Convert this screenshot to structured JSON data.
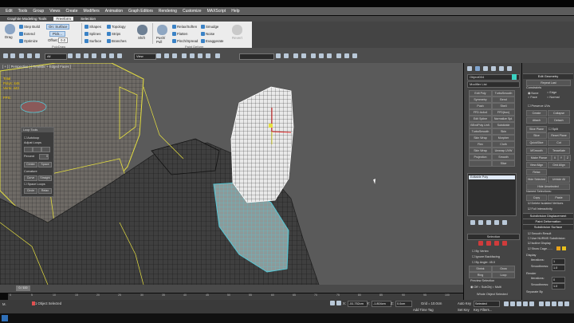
{
  "menu": [
    "Edit",
    "Tools",
    "Group",
    "Views",
    "Create",
    "Modifiers",
    "Animation",
    "Graph Editors",
    "Rendering",
    "Customize",
    "MAXScript",
    "Help"
  ],
  "ribbon_tabs": [
    "Graphite Modeling Tools",
    "Freeform",
    "Selection"
  ],
  "ribbon": {
    "step_build": "Step Build",
    "extend": "Extend",
    "optimize": "Optimize",
    "drag": "Drag",
    "on_surface": "On: Surface",
    "pick": "Pick...",
    "offset_label": "Offset:",
    "offset_value": "0.0",
    "shapes": "Shapes",
    "splines": "Splines",
    "surface": "Surface",
    "topology": "Topology",
    "strips": "Strips",
    "branches": "Branches",
    "shift": "Shift",
    "push_pull": "Push/ Pull",
    "relax_soften": "Relax/Soften",
    "flatten": "Flatten",
    "pinch_spread": "Pinch/Spread",
    "smudge": "Smudge",
    "noise": "Noise",
    "exaggerate": "Exaggerate",
    "revert": "Revert",
    "group_polydraw": "PolyDraw",
    "group_paint": "Paint Deform"
  },
  "toolbar": {
    "filter": "All",
    "view": "View",
    "selection_set": ""
  },
  "viewport": {
    "label": "[ + ] [ Perspective ] [ Realistic + Edged Faces ]",
    "stats_labels": [
      "Total",
      "Polys:",
      "Verts:",
      "FPS:"
    ],
    "stats_values": [
      "",
      "445",
      "443",
      ""
    ]
  },
  "loop_tools": {
    "title": "Loop Tools",
    "autoloop": "Autoloop",
    "adjust_loops": "Adjust Loops",
    "percent_label": "Percent",
    "percent_value": "0",
    "center": "Center",
    "space": "Space",
    "curvature": "Curvature",
    "curve": "Curve",
    "straight": "Straight",
    "space_loops": "Space Loops",
    "circle": "Circle",
    "relax": "Relax"
  },
  "modify_panel": {
    "object_name": "Object004",
    "modifier_list": "Modifier List",
    "buttons": [
      [
        "Edit Poly",
        "TurboSmooth"
      ],
      [
        "Symmetry",
        "Bend"
      ],
      [
        "Push",
        "Shell"
      ],
      [
        "FFD 4x4x4",
        "FFD(box)"
      ],
      [
        "Edit Spline",
        "Normalize Spl."
      ],
      [
        "BEndPoly Unfl.",
        "Subdivide"
      ],
      [
        "TurboSmooth",
        "Skin"
      ],
      [
        "Skin Wrap",
        "Morpher"
      ],
      [
        "Flex",
        "Cloth"
      ],
      [
        "Skin Wrap",
        "Unwrap UVW"
      ],
      [
        "Projection",
        "Smooth"
      ],
      [
        "",
        "Slice"
      ]
    ],
    "stack_item": "Editable Poly",
    "selection_header": "Selection",
    "by_vertex": "By Vertex",
    "ignore_backfacing": "Ignore Backfacing",
    "by_angle": "By Angle:",
    "by_angle_value": "45.0",
    "shrink": "Shrink",
    "grow": "Grow",
    "ring": "Ring",
    "loop": "Loop",
    "preview_selection": "Preview Selection",
    "off": "Off",
    "subobj": "SubObj",
    "multi": "Multi",
    "whole_selected": "Whole Object Selected"
  },
  "right_panel": {
    "edit_geometry": "Edit Geometry",
    "repeat_last": "Repeat Last",
    "constraints": "Constraints",
    "none": "None",
    "edge": "Edge",
    "face": "Face",
    "normal": "Normal",
    "preserve_uvs": "Preserve UVs",
    "create": "Create",
    "collapse": "Collapse",
    "attach": "Attach",
    "detach": "Detach",
    "slice_plane": "Slice Plane",
    "split": "Split",
    "slice": "Slice",
    "reset_plane": "Reset Plane",
    "quickslice": "QuickSlice",
    "cut": "Cut",
    "msmooth": "MSmooth",
    "tessellate": "Tessellate",
    "make_planar": "Make Planar",
    "x": "X",
    "y": "Y",
    "z": "Z",
    "view_align": "View Align",
    "grid_align": "Grid Align",
    "relax": "Relax",
    "hide_selected": "Hide Selected",
    "unhide_all": "Unhide All",
    "hide_unselected": "Hide Unselected",
    "named_selections": "Named Selections:",
    "copy": "Copy",
    "paste": "Paste",
    "delete_isolated": "Delete Isolated Vertices",
    "full_interactivity": "Full Interactivity",
    "subdivision_displacement": "Subdivision Displacement",
    "paint_deformation": "Paint Deformation",
    "subdivision_surface": "Subdivision Surface",
    "smooth_result": "Smooth Result",
    "use_nurms": "Use NURMS Subdivision",
    "isoline_display": "Isoline Display",
    "show_cage": "Show Cage.......",
    "display": "Display",
    "iterations": "Iterations:",
    "iterations_value": "1",
    "smoothness": "Smoothness:",
    "smoothness_value": "1.0",
    "render": "Render",
    "render_iterations": "Iterations:",
    "render_iterations_value": "0",
    "render_smoothness": "Smoothness:",
    "render_smoothness_value": "1.0",
    "separate_by": "Separate By"
  },
  "timeline": {
    "frame": "0 / 100",
    "ticks": [
      "0",
      "5",
      "10",
      "15",
      "20",
      "25",
      "30",
      "35",
      "40",
      "45",
      "50",
      "55",
      "60",
      "65",
      "70",
      "75",
      "80",
      "85",
      "90",
      "95",
      "100"
    ]
  },
  "status": {
    "selected": "1 Object Selected",
    "x_label": "X:",
    "x_value": "-51.752cm",
    "y_label": "Y:",
    "y_value": "-1.804cm",
    "z_label": "Z:",
    "z_value": "0.0cm",
    "grid": "Grid = 10.0cm",
    "autokey": "Auto Key",
    "selected_dd": "Selected",
    "setkey": "Set Key",
    "key_filters": "Key Filters...",
    "add_time_tag": "Add Time Tag",
    "welcome": "M."
  },
  "colors": {
    "accent": "#3a82c6",
    "mesh_wire": "#1e1e1e",
    "cage_yellow": "#e6e040",
    "cage_cyan": "#56c8d6",
    "swatch": "#e8a21c"
  }
}
